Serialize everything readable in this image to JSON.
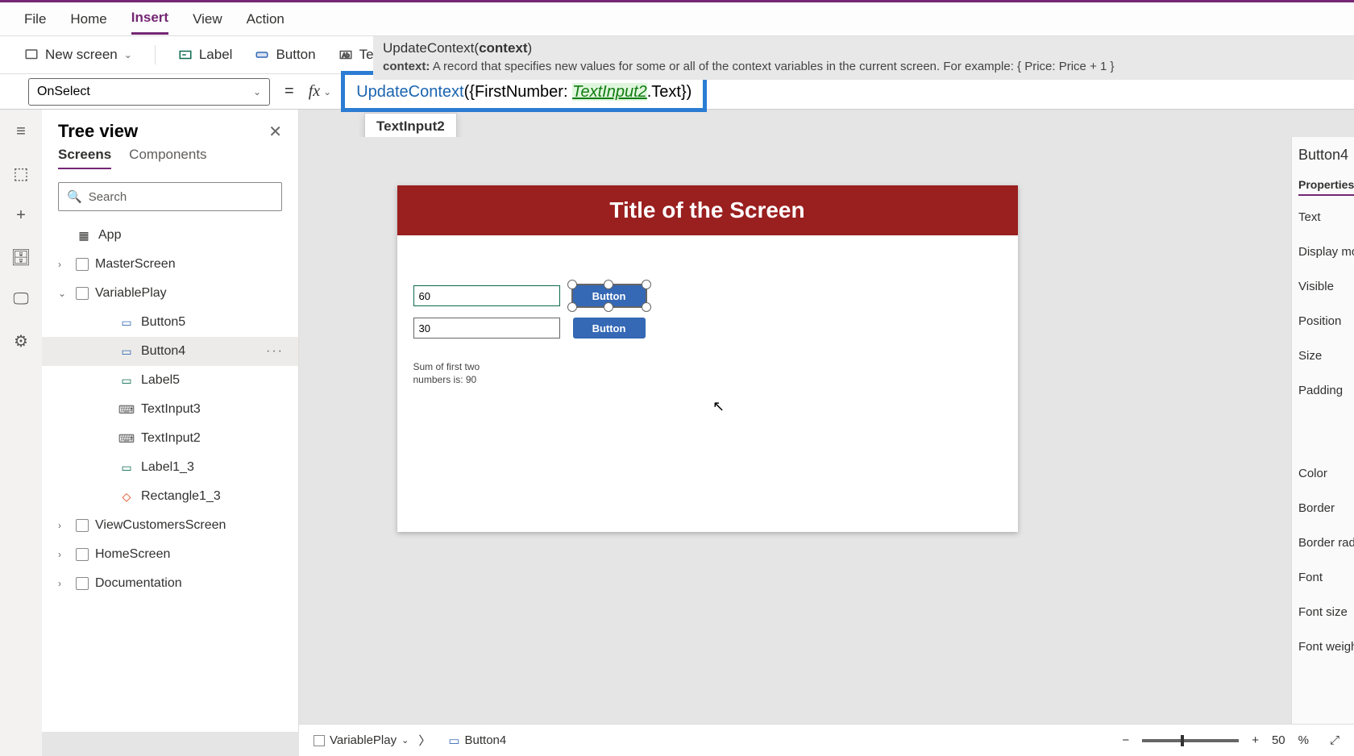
{
  "menu": {
    "file": "File",
    "home": "Home",
    "insert": "Insert",
    "view": "View",
    "action": "Action"
  },
  "toolbar": {
    "newscreen": "New screen",
    "label": "Label",
    "button": "Button",
    "text": "Text"
  },
  "help": {
    "fn": "UpdateContext",
    "arg": "context",
    "desc_label": "context:",
    "desc_text": "A record that specifies new values for some or all of the context variables in the current screen. For example: { Price: Price + 1 }"
  },
  "prop_selector": "OnSelect",
  "formula": {
    "kw": "UpdateContext",
    "open": "({FirstNumber: ",
    "ref": "TextInput2",
    "tail": ".Text})"
  },
  "intellisense": "TextInput2",
  "tree": {
    "title": "Tree view",
    "tabs": {
      "screens": "Screens",
      "components": "Components"
    },
    "search": "Search",
    "items": {
      "app": "App",
      "master": "MasterScreen",
      "varplay": "VariablePlay",
      "btn5": "Button5",
      "btn4": "Button4",
      "lbl5": "Label5",
      "ti3": "TextInput3",
      "ti2": "TextInput2",
      "lbl13": "Label1_3",
      "rect": "Rectangle1_3",
      "view": "ViewCustomersScreen",
      "home": "HomeScreen",
      "doc": "Documentation"
    }
  },
  "screen": {
    "title": "Title of the Screen",
    "in1": "60",
    "in2": "30",
    "btn": "Button",
    "sum": "Sum of first two numbers is: 90"
  },
  "right": {
    "name": "Button4",
    "tab": "Properties",
    "props": {
      "text": "Text",
      "display": "Display mode",
      "visible": "Visible",
      "position": "Position",
      "size": "Size",
      "padding": "Padding",
      "color": "Color",
      "border": "Border",
      "radius": "Border radius",
      "font": "Font",
      "fsize": "Font size",
      "fweight": "Font weight"
    }
  },
  "status": {
    "screen": "VariablePlay",
    "ctrl": "Button4",
    "zoom": "50",
    "pct": "%"
  }
}
